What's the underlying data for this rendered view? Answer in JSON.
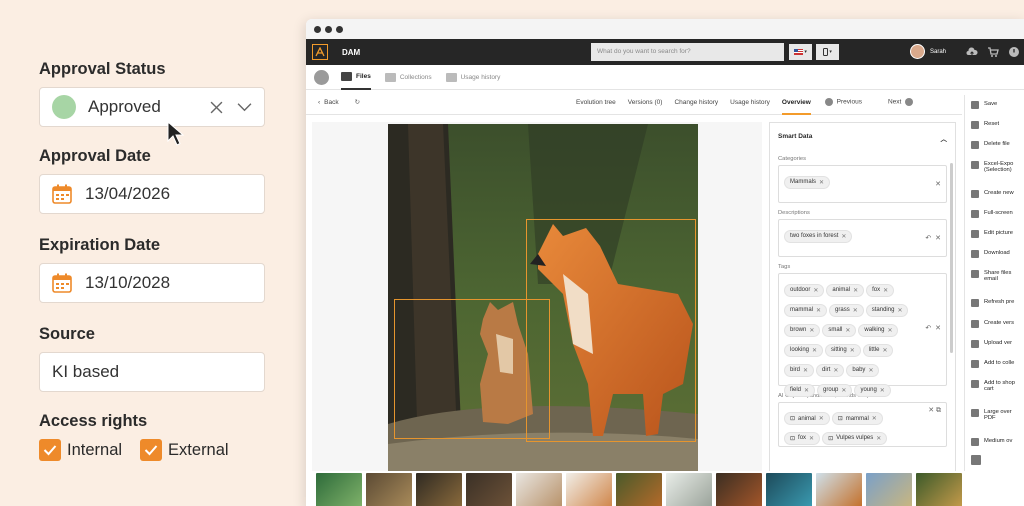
{
  "approval": {
    "status_label": "Approval Status",
    "status_value": "Approved",
    "status_color": "#a7d5a5",
    "approval_date_label": "Approval Date",
    "approval_date": "13/04/2026",
    "expiration_date_label": "Expiration Date",
    "expiration_date": "13/10/2028",
    "source_label": "Source",
    "source_value": "KI based",
    "access_label": "Access rights",
    "access_options": [
      {
        "label": "Internal",
        "checked": true
      },
      {
        "label": "External",
        "checked": true
      }
    ]
  },
  "accent_color": "#ee8a2a",
  "app": {
    "name": "DAM",
    "search_placeholder": "What do you want to search for?",
    "user_name": "Sarah",
    "icons": [
      "cloud-upload-icon",
      "cart-icon",
      "power-icon"
    ]
  },
  "tabs": [
    {
      "label": "Files",
      "active": true
    },
    {
      "label": "Collections",
      "active": false
    },
    {
      "label": "Usage history",
      "active": false
    }
  ],
  "nav": {
    "back": "Back",
    "links": [
      "Evolution tree",
      "Versions (0)",
      "Change history",
      "Usage history",
      "Overview"
    ],
    "active": "Overview",
    "previous": "Previous",
    "next": "Next"
  },
  "smart_data": {
    "title": "Smart Data",
    "categories_label": "Categories",
    "categories": [
      "Mammals"
    ],
    "descriptions_label": "Descriptions",
    "descriptions": [
      "two foxes in forest"
    ],
    "tags_label": "Tags",
    "tags": [
      [
        "outdoor",
        "animal",
        "fox"
      ],
      [
        "mammal",
        "grass",
        "standing"
      ],
      [
        "brown",
        "small",
        "walking"
      ],
      [
        "looking",
        "sitting",
        "little"
      ],
      [
        "bird",
        "dirt",
        "baby"
      ],
      [
        "field",
        "group",
        "young"
      ]
    ],
    "ai_objects_label": "AI Objects (landmarks, brands etc.)",
    "ai_objects": [
      [
        "animal",
        "mammal"
      ],
      [
        "fox",
        "Vulpes vulpes"
      ]
    ]
  },
  "actions": [
    "Save",
    "Reset",
    "Delete file",
    "Excel-Expo (Selection)",
    "Create new",
    "Full-screen",
    "Edit picture",
    "Download",
    "Share files email",
    "Refresh pre",
    "Create vers",
    "Upload ver",
    "Add to colle",
    "Add to shop cart",
    "Large over PDF",
    "Medium ov"
  ]
}
